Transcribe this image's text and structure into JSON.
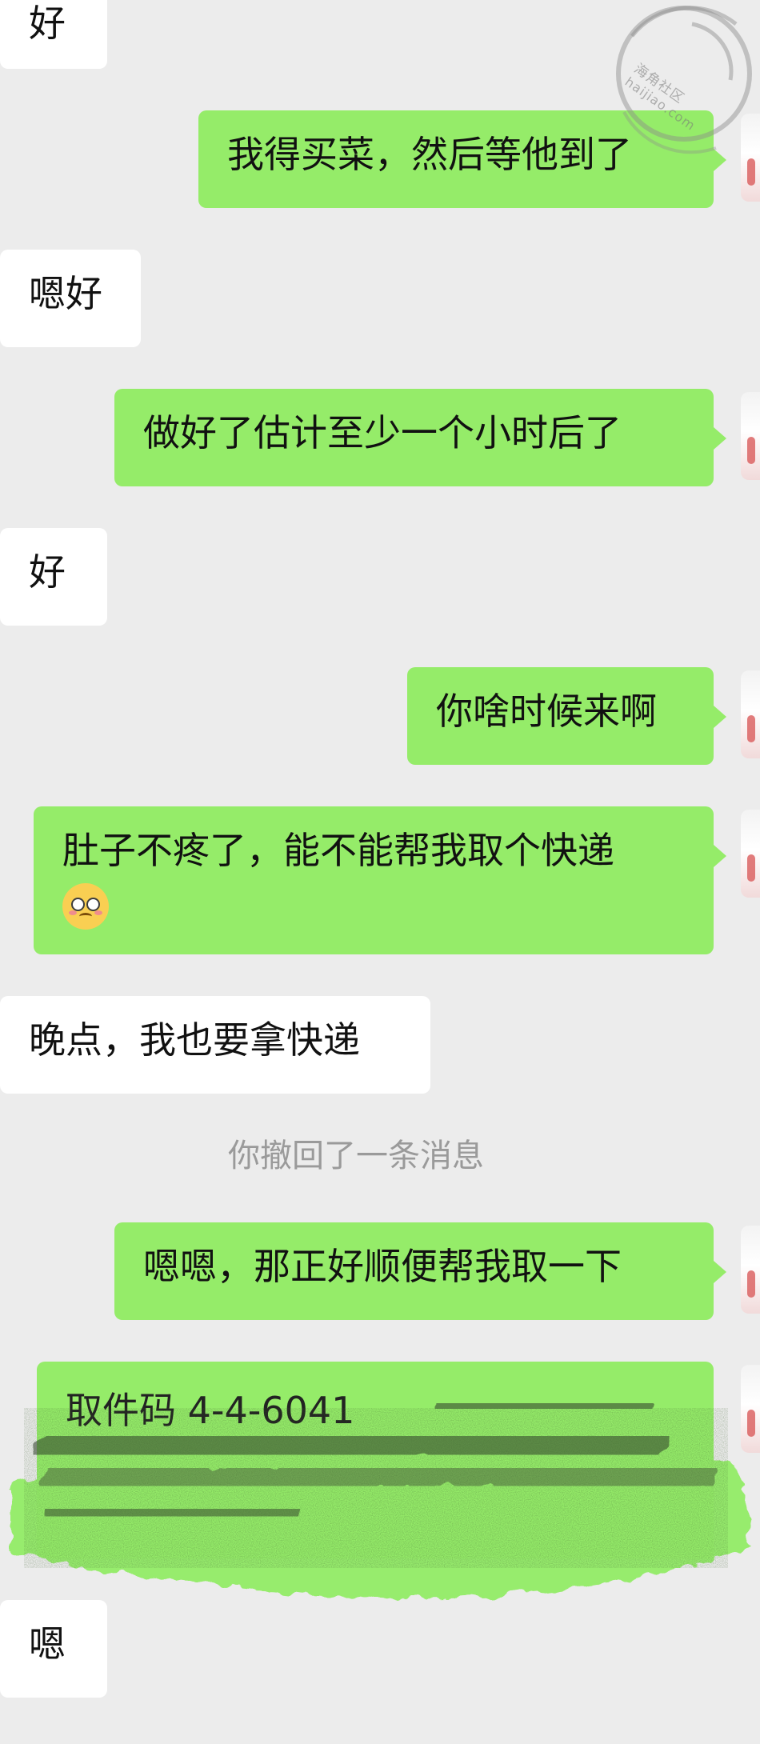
{
  "messages": [
    {
      "id": "m1",
      "side": "incoming",
      "text": "好"
    },
    {
      "id": "m2",
      "side": "outgoing",
      "text": "我得买菜，然后等他到了"
    },
    {
      "id": "m3",
      "side": "incoming",
      "text": "嗯好"
    },
    {
      "id": "m4",
      "side": "outgoing",
      "text": "做好了估计至少一个小时后了"
    },
    {
      "id": "m5",
      "side": "incoming",
      "text": "好"
    },
    {
      "id": "m6",
      "side": "outgoing",
      "text": "你啥时候来啊"
    },
    {
      "id": "m7",
      "side": "outgoing",
      "text": "肚子不疼了，能不能帮我取个快递",
      "emoji": "flushed-face-emoji"
    },
    {
      "id": "m8",
      "side": "incoming",
      "text": "晚点，我也要拿快递"
    },
    {
      "id": "sys1",
      "side": "system",
      "text": "你撤回了一条消息"
    },
    {
      "id": "m9",
      "side": "outgoing",
      "text": "嗯嗯，那正好顺便帮我取一下"
    },
    {
      "id": "m10",
      "side": "outgoing",
      "text": "取件码 4-4-6041",
      "redacted": true
    },
    {
      "id": "m11",
      "side": "incoming",
      "text": "嗯"
    }
  ],
  "watermark": {
    "brand": "海角社区",
    "domain": "haijiao.com"
  },
  "colors": {
    "background": "#ececec",
    "incoming_bubble": "#ffffff",
    "outgoing_bubble": "#95ec69",
    "system_text": "#9a9a9a",
    "text": "#111111"
  }
}
